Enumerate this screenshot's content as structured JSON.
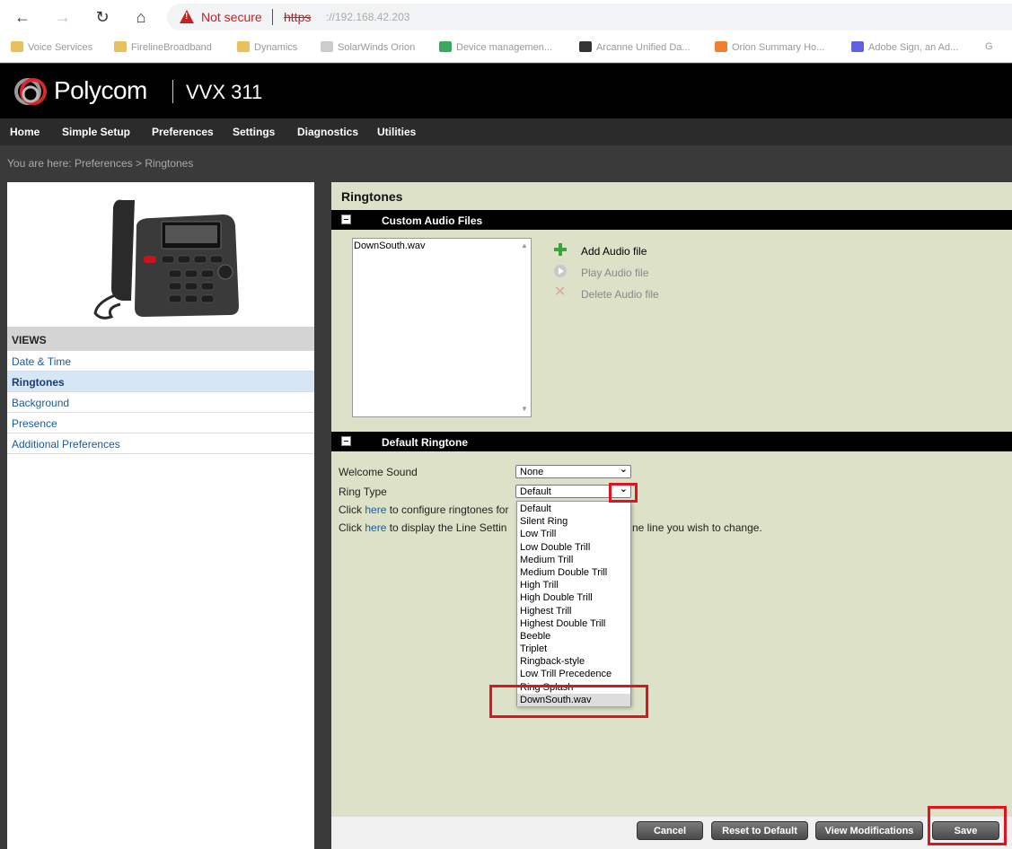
{
  "browser": {
    "back_icon": "←",
    "forward_icon": "→",
    "reload_icon": "↻",
    "home_icon": "⌂",
    "security": "Not secure",
    "url_scheme": "https",
    "url_rest": "://192.168.42.203"
  },
  "bookmarks": [
    {
      "label": "Voice Services",
      "color": "#e8c060"
    },
    {
      "label": "FirelineBroadband",
      "color": "#e8c060"
    },
    {
      "label": "Dynamics",
      "color": "#e8c060"
    },
    {
      "label": "SolarWinds Orion",
      "color": "#cccccc"
    },
    {
      "label": "Device managemen...",
      "color": "#3aa860"
    },
    {
      "label": "Arcanne Unified Da...",
      "color": "#333333"
    },
    {
      "label": "Orion Summary Ho...",
      "color": "#f08030"
    },
    {
      "label": "Adobe Sign, an Ad...",
      "color": "#6060e0"
    },
    {
      "label": "G",
      "color": "#ffffff"
    }
  ],
  "header": {
    "brand": "Polycom",
    "model": "VVX 311"
  },
  "menu": [
    "Home",
    "Simple Setup",
    "Preferences",
    "Settings",
    "Diagnostics",
    "Utilities"
  ],
  "breadcrumb": "You are here: Preferences > Ringtones",
  "views": {
    "heading": "VIEWS",
    "items": [
      "Date & Time",
      "Ringtones",
      "Background",
      "Presence",
      "Additional Preferences"
    ],
    "active_index": 1
  },
  "main": {
    "title": "Ringtones",
    "custom_section": "Custom Audio Files",
    "files": [
      "DownSouth.wav"
    ],
    "actions": {
      "add": "Add Audio file",
      "play": "Play Audio file",
      "delete": "Delete Audio file"
    },
    "default_section": "Default Ringtone",
    "welcome_label": "Welcome Sound",
    "welcome_value": "None",
    "ring_label": "Ring Type",
    "ring_value": "Default",
    "info1_pre": "Click ",
    "info1_link": "here",
    "info1_post": " to configure ringtones for",
    "info2_pre": "Click ",
    "info2_link": "here",
    "info2_post": " to display the Line Settin",
    "info2_tail": "ne line you wish to change."
  },
  "ring_options": [
    "Default",
    "Silent Ring",
    "Low Trill",
    "Low Double Trill",
    "Medium Trill",
    "Medium Double Trill",
    "High Trill",
    "High Double Trill",
    "Highest Trill",
    "Highest Double Trill",
    "Beeble",
    "Triplet",
    "Ringback-style",
    "Low Trill Precedence",
    "Ring Splash",
    "DownSouth.wav"
  ],
  "buttons": {
    "cancel": "Cancel",
    "reset": "Reset to Default",
    "view_mods": "View Modifications",
    "save": "Save"
  },
  "colors": {
    "highlight_box": "#e0141e",
    "panel_bg": "#dde1c8",
    "link": "#1a5a9a"
  }
}
